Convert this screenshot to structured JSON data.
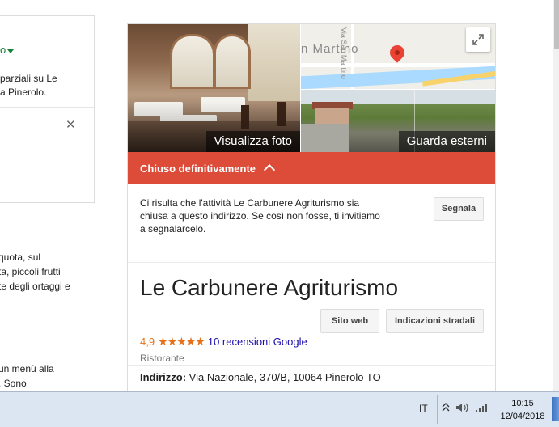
{
  "left": {
    "status": "o",
    "partial_line1": "parziali su Le",
    "partial_line2": "a Pinerolo.",
    "para1": [
      "quota, sul",
      "ta, piccoli frutti",
      "te degli ortaggi e"
    ],
    "para2": [
      "un menù alla",
      ". Sono"
    ]
  },
  "panel": {
    "photos_label": "Visualizza foto",
    "map_label": "n Martino",
    "map_vlabel": "Via San Martino",
    "street_label": "Guarda esterni",
    "closed_label": "Chiuso definitivamente",
    "notice": "Ci risulta che l'attività Le Carbunere Agriturismo sia chiusa a questo indirizzo. Se così non fosse, ti invitiamo a segnalarcelo.",
    "report_button": "Segnala",
    "title": "Le Carbunere Agriturismo",
    "website_button": "Sito web",
    "directions_button": "Indicazioni stradali",
    "rating": "4,9",
    "stars": "★★★★★",
    "reviews": "10 recensioni Google",
    "category": "Ristorante",
    "address_label": "Indirizzo:",
    "address_value": " Via Nazionale, 370/B, 10064 Pinerolo TO"
  },
  "taskbar": {
    "language": "IT",
    "time": "10:15",
    "date": "12/04/2018"
  },
  "colors": {
    "closed_bar": "#dd4b39",
    "rating": "#e7711b",
    "link": "#1a0dab"
  }
}
